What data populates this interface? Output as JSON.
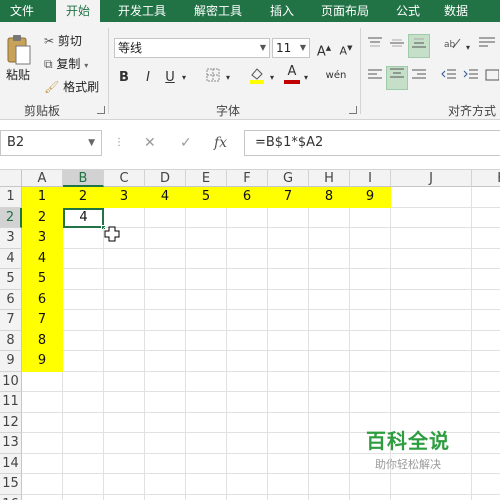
{
  "tabs": [
    "文件",
    "开始",
    "开发工具",
    "解密工具",
    "插入",
    "页面布局",
    "公式",
    "数据"
  ],
  "active_tab": "开始",
  "clipboard": {
    "paste": "粘贴",
    "cut": "剪切",
    "copy": "复制",
    "format_painter": "格式刷",
    "label": "剪贴板"
  },
  "font_group": {
    "font_name": "等线",
    "font_size": "11",
    "grow": "A",
    "shrink": "A",
    "bold": "B",
    "italic": "I",
    "underline": "U",
    "phonetic": "wén",
    "label": "字体",
    "highlight_color": "#ffff00",
    "font_color": "#c00000"
  },
  "align_group": {
    "label": "对齐方式"
  },
  "formula_bar": {
    "name_box": "B2",
    "cancel": "✕",
    "enter": "✓",
    "fx": "fx",
    "formula": "=B$1*$A2"
  },
  "sheet": {
    "columns": [
      "A",
      "B",
      "C",
      "D",
      "E",
      "F",
      "G",
      "H",
      "I",
      "J",
      "K"
    ],
    "rows": [
      "1",
      "2",
      "3",
      "4",
      "5",
      "6",
      "7",
      "8",
      "9",
      "10",
      "11",
      "12",
      "13",
      "14",
      "15",
      "16"
    ],
    "row1_values": [
      "1",
      "2",
      "3",
      "4",
      "5",
      "6",
      "7",
      "8",
      "9"
    ],
    "colA_values": [
      "2",
      "3",
      "4",
      "5",
      "6",
      "7",
      "8",
      "9"
    ],
    "active_cell": "B2",
    "active_cell_value": "4",
    "highlight_color": "#ffff00"
  },
  "watermark": {
    "main": "百科全说",
    "sub": "助你轻松解决"
  },
  "colors": {
    "accent": "#217346"
  }
}
